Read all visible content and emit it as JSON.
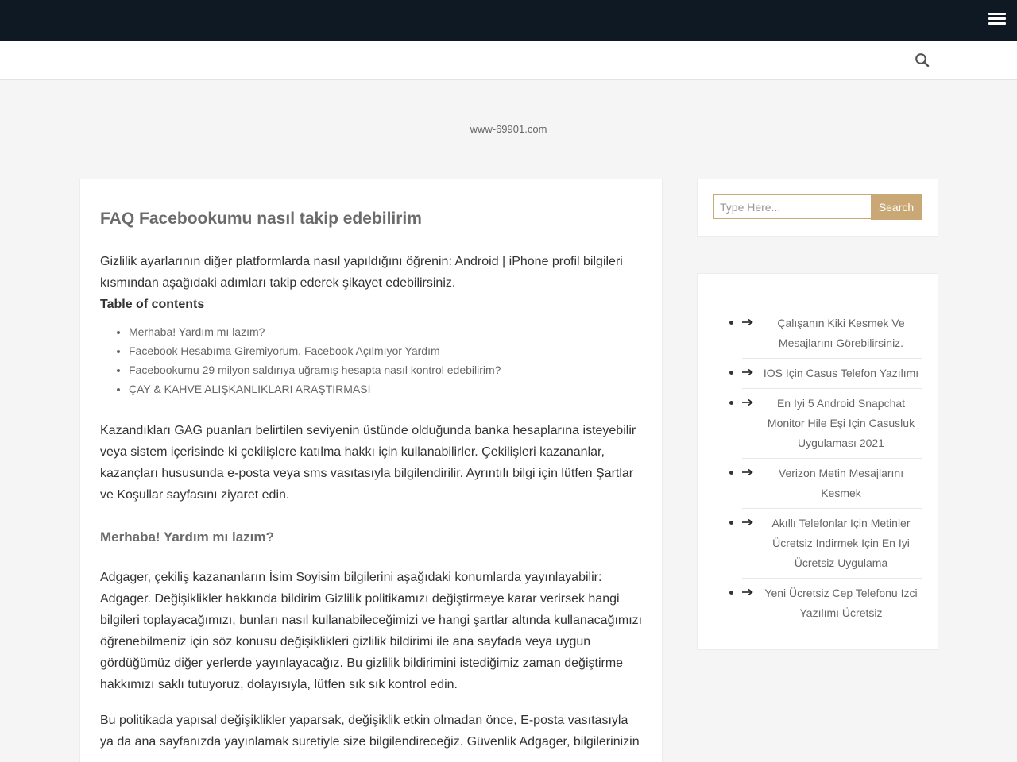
{
  "site": {
    "url": "www-69901.com"
  },
  "article": {
    "title": "FAQ Facebookumu nasıl takip edebilirim",
    "intro": "Gizlilik ayarlarının diğer platformlarda nasıl yapıldığını öğrenin: Android | iPhone profil bilgileri kısmından aşağıdaki adımları takip ederek şikayet edebilirsiniz.",
    "toc_title": "Table of contents",
    "toc": [
      "Merhaba! Yardım mı lazım?",
      "Facebook Hesabıma Giremiyorum, Facebook Açılmıyor Yardım",
      "Facebookumu 29 milyon saldırıya uğramış hesapta nasıl kontrol edebilirim?",
      "ÇAY & KAHVE ALIŞKANLIKLARI ARAŞTIRMASI"
    ],
    "para2": "Kazandıkları GAG puanları belirtilen seviyenin üstünde olduğunda banka hesaplarına isteyebilir veya sistem içerisinde ki çekilişlere katılma hakkı için kullanabilirler. Çekilişleri kazananlar, kazançları hususunda e-posta veya sms vasıtasıyla bilgilendirilir. Ayrıntılı bilgi için lütfen Şartlar ve Koşullar sayfasını ziyaret edin.",
    "subheading": "Merhaba! Yardım mı lazım?",
    "para3": "Adgager, çekiliş kazananların İsim Soyisim bilgilerini aşağıdaki konumlarda yayınlayabilir: Adgager. Değişiklikler hakkında bildirim Gizlilik politikamızı değiştirmeye karar verirsek hangi bilgileri toplayacağımızı, bunları nasıl kullanabileceğimizi ve hangi şartlar altında kullanacağımızı öğrenebilmeniz için söz konusu değişiklikleri gizlilik bildirimi ile ana sayfada veya uygun gördüğümüz diğer yerlerde yayınlayacağız. Bu gizlilik bildirimini istediğimiz zaman değiştirme hakkımızı saklı tutuyoruz, dolayısıyla, lütfen sık sık kontrol edin.",
    "para4": "Bu politikada yapısal değişiklikler yaparsak, değişiklik etkin olmadan önce, E-posta vasıtasıyla ya da ana sayfanızda yayınlamak suretiyle size bilgilendireceğiz. Güvenlik Adgager, bilgilerinizin"
  },
  "sidebar": {
    "search": {
      "placeholder": "Type Here...",
      "button": "Search"
    },
    "posts": [
      "Çalışanın Kiki Kesmek Ve Mesajlarını Görebilirsiniz.",
      "IOS Için Casus Telefon Yazılımı",
      "En İyi 5 Android Snapchat Monitor Hile Eşi Için Casusluk Uygulaması 2021",
      "Verizon Metin Mesajlarını Kesmek",
      "Akıllı Telefonlar Için Metinler Ücretsiz Indirmek Için En Iyi Ücretsiz Uygulama",
      "Yeni Ücretsiz Cep Telefonu Izci Yazılımı Ücretsiz"
    ]
  },
  "icons": {
    "menu": "hamburger-menu-icon",
    "search": "search-icon",
    "bullet_arrow": "arrow-right-icon"
  },
  "colors": {
    "topbar": "#0f1923",
    "accent": "#c9a876",
    "background": "#f5f5f5"
  }
}
